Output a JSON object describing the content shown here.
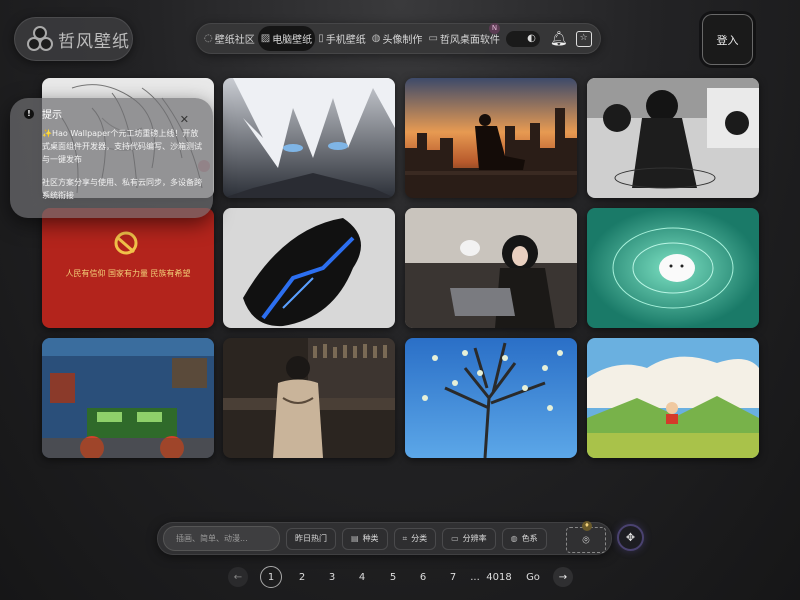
{
  "logo": {
    "text": "哲风壁纸"
  },
  "nav": {
    "items": [
      {
        "label": "壁纸社区",
        "icon": "chat-bubble-icon"
      },
      {
        "label": "电脑壁纸",
        "icon": "image-icon",
        "active": true
      },
      {
        "label": "手机壁纸",
        "icon": "phone-icon"
      },
      {
        "label": "头像制作",
        "icon": "avatar-icon"
      },
      {
        "label": "哲风桌面软件",
        "icon": "monitor-icon"
      }
    ],
    "badge": "N"
  },
  "login": {
    "label": "登入"
  },
  "toast": {
    "title": "提示",
    "line1": "✨Hao Wallpaper个元工坊重磅上线！开放式桌面组件开发器，支持代码编写、沙箱测试与一键发布",
    "line2": "社区方案分享与使用、私有云同步，多设备跨系统衔接"
  },
  "wallpapers": [
    {
      "name": "sketch-anime-girl"
    },
    {
      "name": "white-haired-anime-boy"
    },
    {
      "name": "sunset-city-rooftop"
    },
    {
      "name": "dark-haired-girl-grayscale"
    },
    {
      "name": "red-banner",
      "caption": "人民有信仰 国家有力量 民族有希望"
    },
    {
      "name": "ink-warrior-blue"
    },
    {
      "name": "girl-with-cat-laptop"
    },
    {
      "name": "white-bear-teal-water"
    },
    {
      "name": "pixel-game-room"
    },
    {
      "name": "bar-woman-back"
    },
    {
      "name": "blossom-tree-blue-sky"
    },
    {
      "name": "cartoon-boy-meadow"
    }
  ],
  "filterbar": {
    "search_placeholder": "插画、简单、动漫...",
    "buttons": [
      {
        "label": "昨日热门",
        "icon": ""
      },
      {
        "label": "种类",
        "icon": "grid-icon"
      },
      {
        "label": "分类",
        "icon": "crop-icon"
      },
      {
        "label": "分辨率",
        "icon": "monitor-icon"
      },
      {
        "label": "色系",
        "icon": "palette-icon"
      }
    ],
    "scan_badge": "♦"
  },
  "pagination": {
    "pages": [
      "1",
      "2",
      "3",
      "4",
      "5",
      "6",
      "7"
    ],
    "ellipsis": "...",
    "last": "4018",
    "go": "Go",
    "prev": "←",
    "next": "→",
    "current": "1"
  }
}
